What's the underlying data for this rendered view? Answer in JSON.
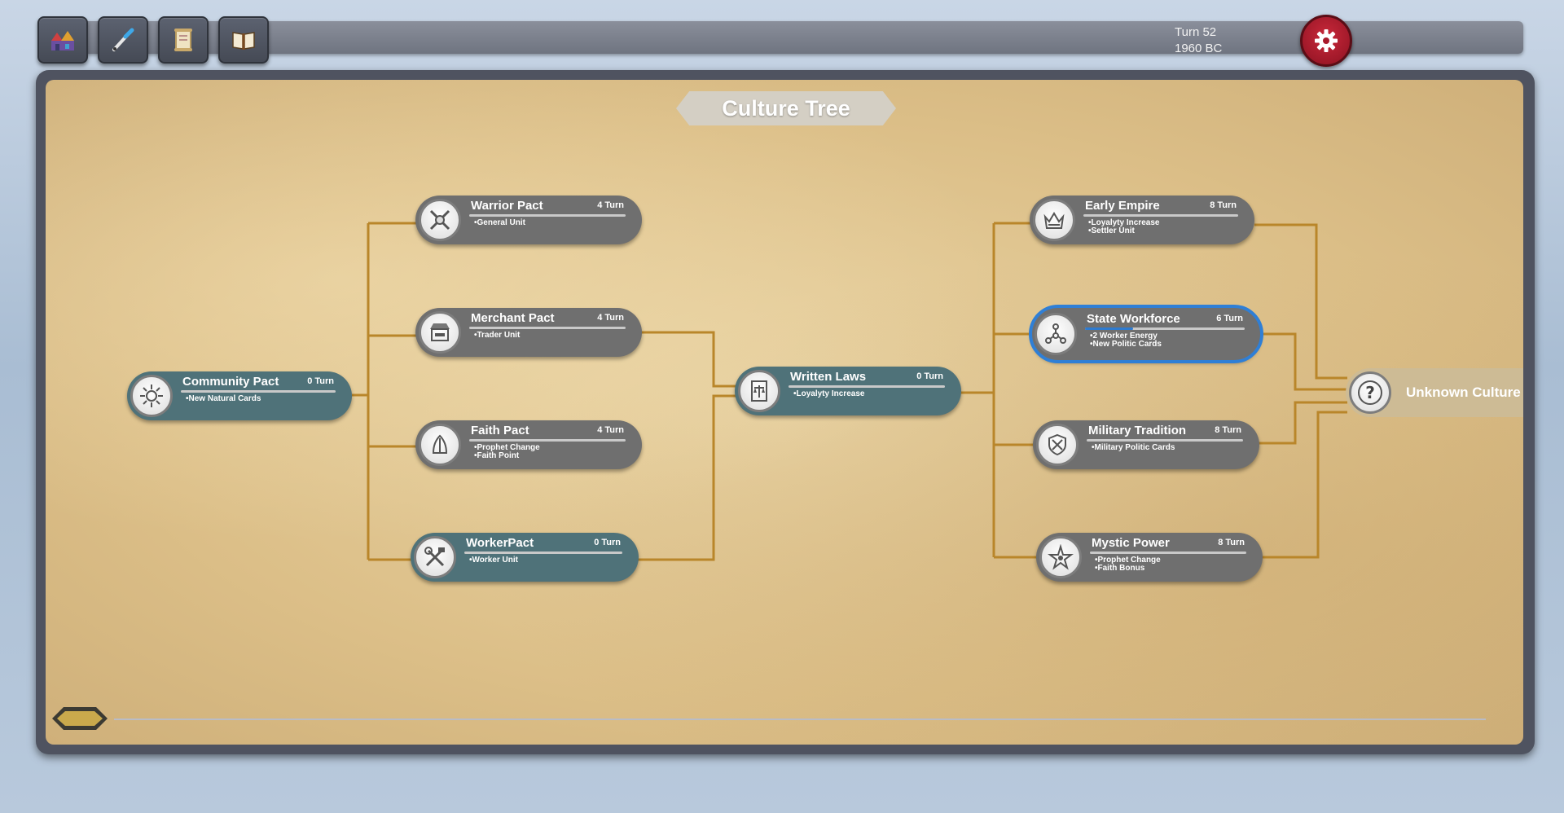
{
  "toolbar": {
    "buttons": [
      {
        "name": "city-button",
        "icon": "city-icon"
      },
      {
        "name": "research-button",
        "icon": "quill-icon"
      },
      {
        "name": "scroll-button",
        "icon": "scroll-icon"
      },
      {
        "name": "codex-button",
        "icon": "book-icon"
      }
    ],
    "turn_label": "Turn 52",
    "year_label": "1960 BC",
    "settings_icon": "gear-icon"
  },
  "panel": {
    "title": "Culture Tree"
  },
  "nodes": {
    "community_pact": {
      "name": "Community Pact",
      "turns": "0 Turn",
      "effects": [
        "•New Natural Cards"
      ],
      "icon": "sun-wheel-icon"
    },
    "warrior_pact": {
      "name": "Warrior Pact",
      "turns": "4 Turn",
      "effects": [
        "•General Unit"
      ],
      "icon": "crossed-swords-icon"
    },
    "merchant_pact": {
      "name": "Merchant Pact",
      "turns": "4 Turn",
      "effects": [
        "•Trader Unit"
      ],
      "icon": "market-stall-icon"
    },
    "faith_pact": {
      "name": "Faith Pact",
      "turns": "4 Turn",
      "effects": [
        "•Prophet Change",
        "•Faith Point"
      ],
      "icon": "praying-hands-icon"
    },
    "worker_pact": {
      "name": "WorkerPact",
      "turns": "0 Turn",
      "effects": [
        "•Worker Unit"
      ],
      "icon": "tools-icon"
    },
    "written_laws": {
      "name": "Written Laws",
      "turns": "0 Turn",
      "effects": [
        "•Loyalyty Increase"
      ],
      "icon": "law-scale-icon"
    },
    "early_empire": {
      "name": "Early Empire",
      "turns": "8 Turn",
      "effects": [
        "•Loyalyty Increase",
        "•Settler Unit"
      ],
      "icon": "crown-icon"
    },
    "state_workforce": {
      "name": "State Workforce",
      "turns": "6 Turn",
      "effects": [
        "•2 Worker Energy",
        "•New Politic Cards"
      ],
      "icon": "people-network-icon",
      "progress": 0.3
    },
    "military_tradition": {
      "name": "Military Tradition",
      "turns": "8 Turn",
      "effects": [
        "•Military Politic Cards"
      ],
      "icon": "shield-sword-icon"
    },
    "mystic_power": {
      "name": "Mystic Power",
      "turns": "8 Turn",
      "effects": [
        "•Prophet Change",
        "•Faith Bonus"
      ],
      "icon": "eye-star-icon"
    }
  },
  "unknown_culture": {
    "label": "Unknown Culture",
    "icon": "question-icon"
  },
  "colors": {
    "connector": "#b9862a",
    "unlocked_node": "#4f7279",
    "locked_node": "#6f6f6f",
    "selected_outline": "#2f7fd6",
    "settings_button": "#b31d30"
  }
}
